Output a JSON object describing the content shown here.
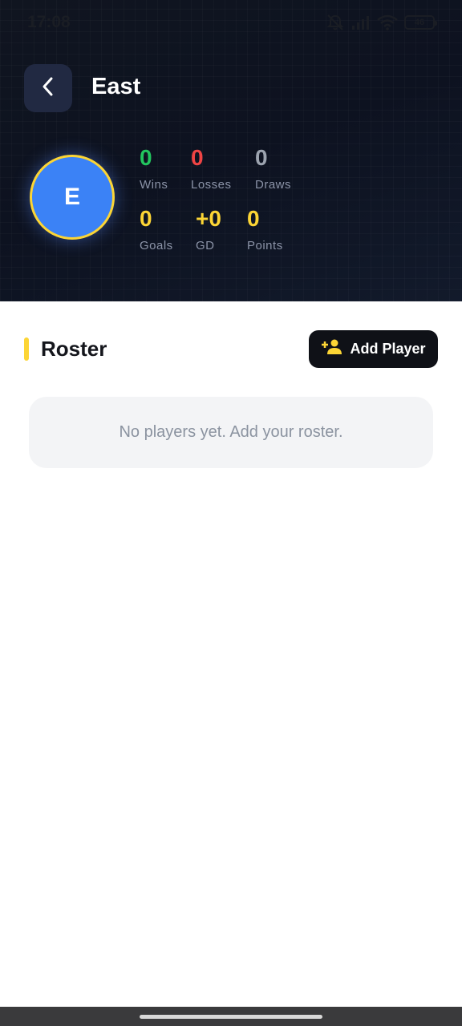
{
  "status_bar": {
    "time": "17:08",
    "battery": "46",
    "icons": [
      "mute-icon",
      "signal-icon",
      "wifi-icon",
      "battery-icon"
    ]
  },
  "header": {
    "title": "East",
    "back_icon": "chevron-left-icon"
  },
  "team": {
    "initial": "E",
    "avatar_color": "#3b82f6",
    "avatar_ring_color": "#fcd535"
  },
  "stats": [
    {
      "value": "0",
      "label": "Wins",
      "color": "#22c55e"
    },
    {
      "value": "0",
      "label": "Losses",
      "color": "#ef4444"
    },
    {
      "value": "0",
      "label": "Draws",
      "color": "#9ca3af"
    },
    {
      "value": "0",
      "label": "Goals",
      "color": "#fcd535"
    },
    {
      "value": "+0",
      "label": "GD",
      "color": "#fcd535"
    },
    {
      "value": "0",
      "label": "Points",
      "color": "#fcd535"
    }
  ],
  "roster": {
    "title": "Roster",
    "add_button_label": "Add Player",
    "add_button_icon": "add-person-icon",
    "empty_message": "No players yet. Add your roster."
  }
}
